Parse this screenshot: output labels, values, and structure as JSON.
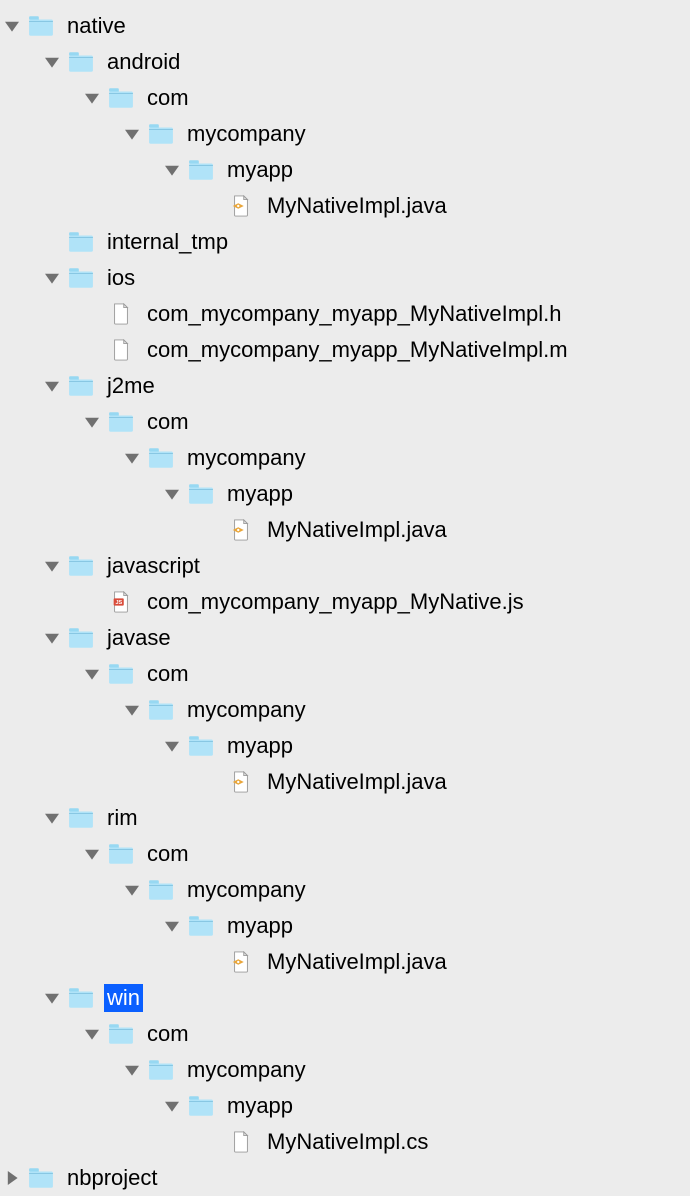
{
  "tree": [
    {
      "depth": 0,
      "type": "folder",
      "expanded": true,
      "label": "native"
    },
    {
      "depth": 1,
      "type": "folder",
      "expanded": true,
      "label": "android"
    },
    {
      "depth": 2,
      "type": "folder",
      "expanded": true,
      "label": "com"
    },
    {
      "depth": 3,
      "type": "folder",
      "expanded": true,
      "label": "mycompany"
    },
    {
      "depth": 4,
      "type": "folder",
      "expanded": true,
      "label": "myapp"
    },
    {
      "depth": 5,
      "type": "java",
      "expanded": null,
      "label": "MyNativeImpl.java"
    },
    {
      "depth": 1,
      "type": "folder",
      "expanded": null,
      "label": "internal_tmp"
    },
    {
      "depth": 1,
      "type": "folder",
      "expanded": true,
      "label": "ios"
    },
    {
      "depth": 2,
      "type": "file",
      "expanded": null,
      "label": "com_mycompany_myapp_MyNativeImpl.h"
    },
    {
      "depth": 2,
      "type": "file",
      "expanded": null,
      "label": "com_mycompany_myapp_MyNativeImpl.m"
    },
    {
      "depth": 1,
      "type": "folder",
      "expanded": true,
      "label": "j2me"
    },
    {
      "depth": 2,
      "type": "folder",
      "expanded": true,
      "label": "com"
    },
    {
      "depth": 3,
      "type": "folder",
      "expanded": true,
      "label": "mycompany"
    },
    {
      "depth": 4,
      "type": "folder",
      "expanded": true,
      "label": "myapp"
    },
    {
      "depth": 5,
      "type": "java",
      "expanded": null,
      "label": "MyNativeImpl.java"
    },
    {
      "depth": 1,
      "type": "folder",
      "expanded": true,
      "label": "javascript"
    },
    {
      "depth": 2,
      "type": "js",
      "expanded": null,
      "label": "com_mycompany_myapp_MyNative.js"
    },
    {
      "depth": 1,
      "type": "folder",
      "expanded": true,
      "label": "javase"
    },
    {
      "depth": 2,
      "type": "folder",
      "expanded": true,
      "label": "com"
    },
    {
      "depth": 3,
      "type": "folder",
      "expanded": true,
      "label": "mycompany"
    },
    {
      "depth": 4,
      "type": "folder",
      "expanded": true,
      "label": "myapp"
    },
    {
      "depth": 5,
      "type": "java",
      "expanded": null,
      "label": "MyNativeImpl.java"
    },
    {
      "depth": 1,
      "type": "folder",
      "expanded": true,
      "label": "rim"
    },
    {
      "depth": 2,
      "type": "folder",
      "expanded": true,
      "label": "com"
    },
    {
      "depth": 3,
      "type": "folder",
      "expanded": true,
      "label": "mycompany"
    },
    {
      "depth": 4,
      "type": "folder",
      "expanded": true,
      "label": "myapp"
    },
    {
      "depth": 5,
      "type": "java",
      "expanded": null,
      "label": "MyNativeImpl.java"
    },
    {
      "depth": 1,
      "type": "folder",
      "expanded": true,
      "label": "win",
      "selected": true
    },
    {
      "depth": 2,
      "type": "folder",
      "expanded": true,
      "label": "com"
    },
    {
      "depth": 3,
      "type": "folder",
      "expanded": true,
      "label": "mycompany"
    },
    {
      "depth": 4,
      "type": "folder",
      "expanded": true,
      "label": "myapp"
    },
    {
      "depth": 5,
      "type": "file",
      "expanded": null,
      "label": "MyNativeImpl.cs"
    },
    {
      "depth": 0,
      "type": "folder",
      "expanded": false,
      "label": "nbproject"
    }
  ]
}
